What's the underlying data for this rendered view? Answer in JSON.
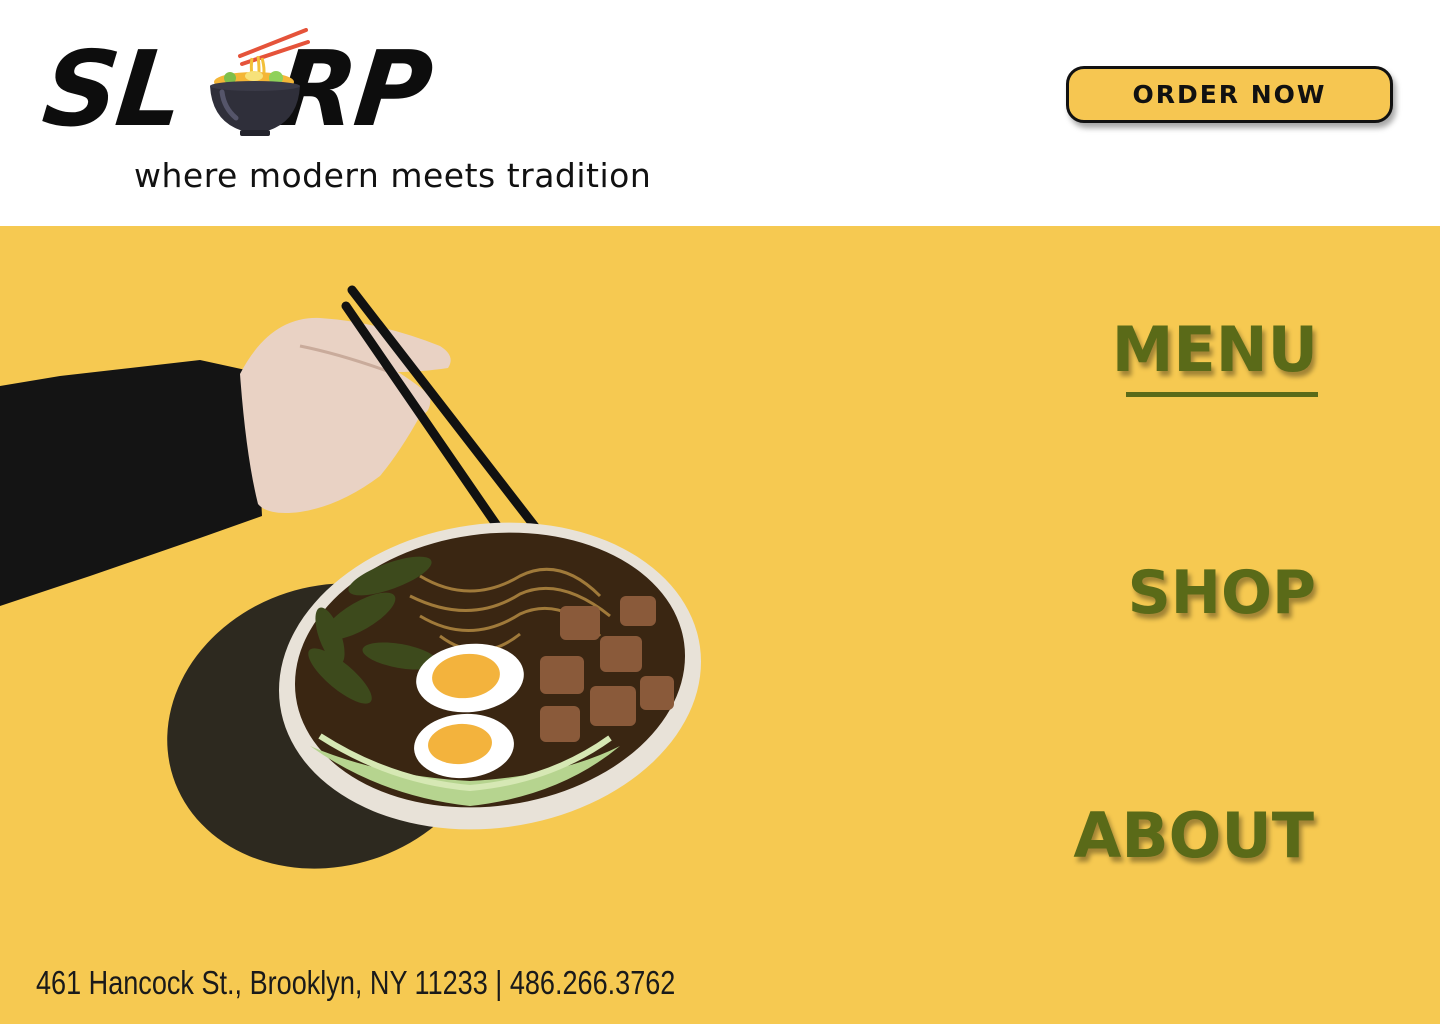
{
  "header": {
    "logo_text_left": "SL",
    "logo_text_right": "RP",
    "logo_icon": "ramen-bowl-icon",
    "tagline": "where modern meets tradition",
    "order_button_label": "ORDER NOW"
  },
  "nav": {
    "menu_label": "MENU",
    "shop_label": "SHOP",
    "about_label": "ABOUT",
    "active": "MENU"
  },
  "hero": {
    "image": "hand-holding-ramen-bowl-with-chopsticks"
  },
  "footer": {
    "address": "461 Hancock St., Brooklyn, NY 11233 | 486.266.3762"
  },
  "colors": {
    "accent_yellow": "#f6c951",
    "nav_green": "#5a6a18",
    "text_dark": "#111111",
    "background": "#ffffff"
  }
}
